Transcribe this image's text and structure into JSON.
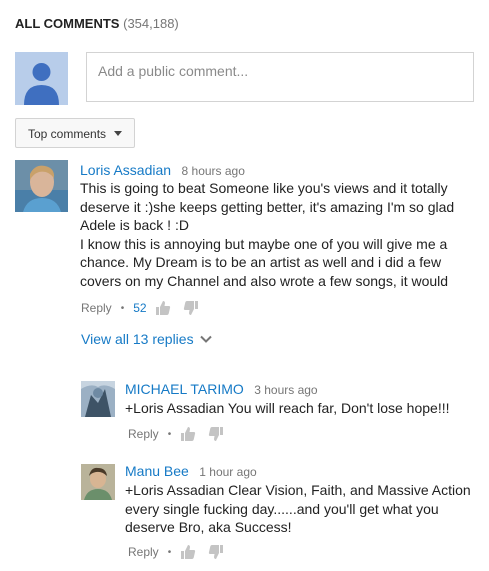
{
  "header": {
    "title": "ALL COMMENTS",
    "count": "(354,188)"
  },
  "composer": {
    "placeholder": "Add a public comment..."
  },
  "sort": {
    "label": "Top comments"
  },
  "comments": [
    {
      "author": "Loris Assadian",
      "time": "8 hours ago",
      "lines": [
        "This is going to beat Someone like you's views and it totally",
        "deserve it :)she keeps getting better, it's amazing I'm so glad",
        "Adele is back ! :D",
        "I know this is annoying but maybe one of you will give me a",
        "chance. My Dream is to be an artist as well and i did a few",
        "covers on my Channel and also wrote a few songs, it would"
      ],
      "reply_label": "Reply",
      "likes": "52"
    }
  ],
  "view_replies": {
    "label": "View all 13 replies"
  },
  "replies": [
    {
      "author": "MICHAEL TARIMO",
      "time": "3 hours ago",
      "lines": [
        "+Loris Assadian You will reach far, Don't lose hope!!!"
      ],
      "reply_label": "Reply"
    },
    {
      "author": "Manu Bee",
      "time": "1 hour ago",
      "lines": [
        "+Loris Assadian Clear Vision, Faith, and Massive Action",
        "every single fucking day......and you'll get what you",
        "deserve Bro, aka Success!"
      ],
      "reply_label": "Reply"
    }
  ],
  "colors": {
    "link": "#167ac6",
    "muted": "#767676",
    "avatar_bg": "#b8cdea",
    "avatar_fg": "#3f6fc0"
  },
  "icons": [
    "default-avatar-icon",
    "caret-down-icon",
    "thumbs-up-icon",
    "thumbs-down-icon",
    "chevron-down-icon"
  ]
}
